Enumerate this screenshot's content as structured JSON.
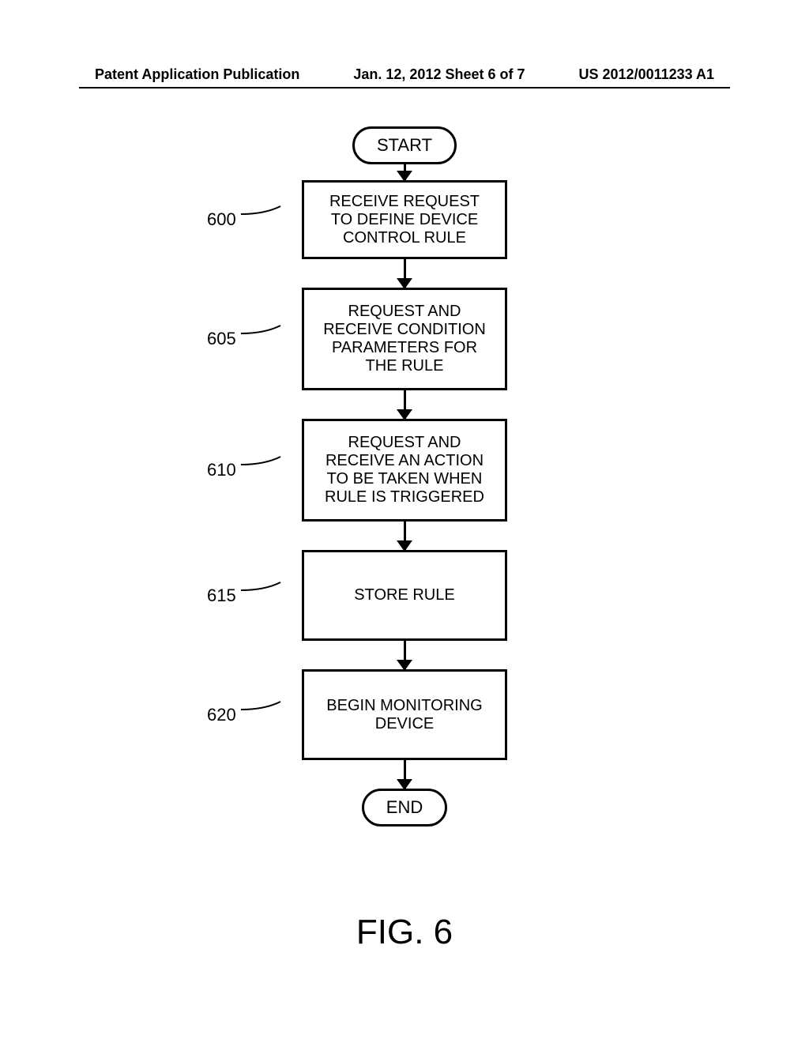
{
  "header": {
    "left": "Patent Application Publication",
    "center": "Jan. 12, 2012  Sheet 6 of 7",
    "right": "US 2012/0011233 A1"
  },
  "flowchart": {
    "start": "START",
    "end": "END",
    "steps": [
      {
        "num": "600",
        "text": "RECEIVE REQUEST TO DEFINE DEVICE CONTROL RULE"
      },
      {
        "num": "605",
        "text": "REQUEST AND RECEIVE CONDITION PARAMETERS FOR THE RULE"
      },
      {
        "num": "610",
        "text": "REQUEST AND RECEIVE AN ACTION TO BE TAKEN WHEN RULE IS TRIGGERED"
      },
      {
        "num": "615",
        "text": "STORE RULE"
      },
      {
        "num": "620",
        "text": "BEGIN MONITORING DEVICE"
      }
    ]
  },
  "figure_label": "FIG. 6"
}
